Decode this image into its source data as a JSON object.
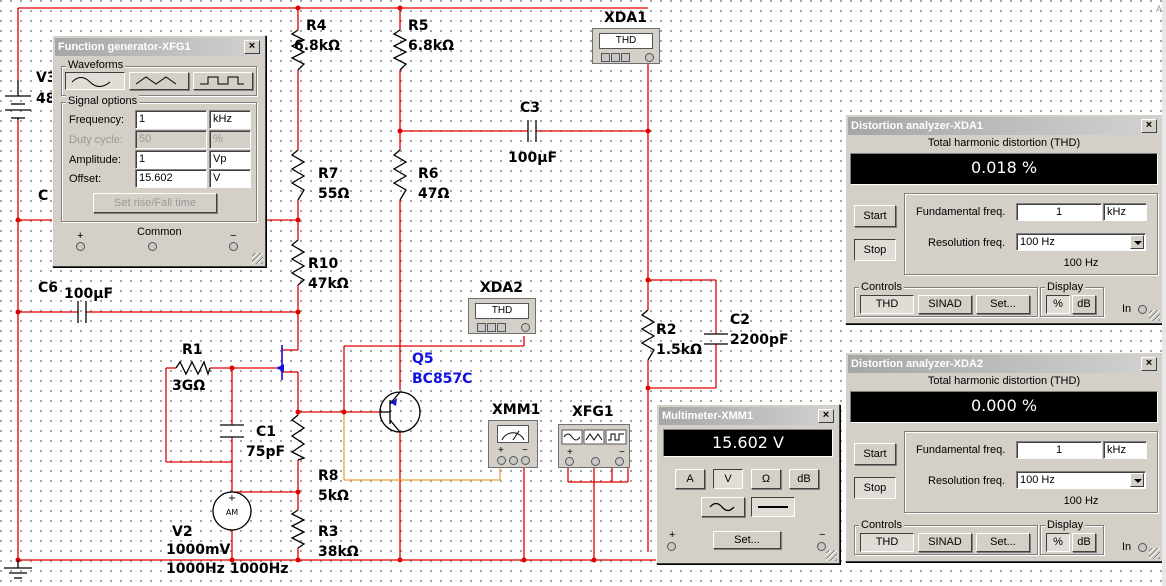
{
  "schematic": {
    "components": [
      {
        "id": "V3",
        "name": "V3",
        "value": "48"
      },
      {
        "id": "C_partial",
        "name": "C"
      },
      {
        "id": "R4",
        "name": "R4",
        "value": "6.8kΩ"
      },
      {
        "id": "R5",
        "name": "R5",
        "value": "6.8kΩ"
      },
      {
        "id": "R7",
        "name": "R7",
        "value": "55Ω"
      },
      {
        "id": "R6",
        "name": "R6",
        "value": "47Ω"
      },
      {
        "id": "R10",
        "name": "R10",
        "value": "47kΩ"
      },
      {
        "id": "C6",
        "name": "C6",
        "value": "100μF"
      },
      {
        "id": "C3",
        "name": "C3",
        "value": "100μF"
      },
      {
        "id": "R1",
        "name": "R1",
        "value": "3GΩ"
      },
      {
        "id": "C1",
        "name": "C1",
        "value": "75pF"
      },
      {
        "id": "Q5",
        "name": "Q5",
        "value": "BC857C"
      },
      {
        "id": "R8",
        "name": "R8",
        "value": "5kΩ"
      },
      {
        "id": "R3",
        "name": "R3",
        "value": "38kΩ"
      },
      {
        "id": "V2",
        "name": "V2",
        "value": "1000mV",
        "value2": "1000Hz 1000Hz"
      },
      {
        "id": "R2",
        "name": "R2",
        "value": "1.5kΩ"
      },
      {
        "id": "C2",
        "name": "C2",
        "value": "2200pF"
      }
    ],
    "instruments": {
      "xda1": {
        "name": "XDA1",
        "screen": "THD"
      },
      "xda2": {
        "name": "XDA2",
        "screen": "THD"
      },
      "xmm1": {
        "name": "XMM1",
        "plus": "+",
        "minus": "−"
      },
      "xfg1": {
        "name": "XFG1"
      },
      "am_label": "AM"
    },
    "colors": {
      "wire": "#e00000",
      "orange_wire": "#e8a040",
      "blue": "#1010e0"
    }
  },
  "function_generator": {
    "title": "Function generator-XFG1",
    "close": "×",
    "waveforms_label": "Waveforms",
    "signal_options_label": "Signal options",
    "frequency": {
      "label": "Frequency:",
      "value": "1",
      "unit": "kHz"
    },
    "duty_cycle": {
      "label": "Duty cycle:",
      "value": "50",
      "unit": "%"
    },
    "amplitude": {
      "label": "Amplitude:",
      "value": "1",
      "unit": "Vp"
    },
    "offset": {
      "label": "Offset:",
      "value": "15.602",
      "unit": "V"
    },
    "set_rise_fall": "Set rise/Fall time",
    "plus": "+",
    "common": "Common",
    "minus": "−"
  },
  "distortion_xda1": {
    "title": "Distortion analyzer-XDA1",
    "close": "×",
    "thd_label": "Total harmonic distortion (THD)",
    "reading": "0.018 %",
    "start": "Start",
    "stop": "Stop",
    "fundamental": {
      "label": "Fundamental freq.",
      "value": "1",
      "unit": "kHz"
    },
    "resolution": {
      "label": "Resolution freq.",
      "value": "100 Hz",
      "sub": "100 Hz"
    },
    "controls_label": "Controls",
    "thd_btn": "THD",
    "sinad_btn": "SINAD",
    "set_btn": "Set...",
    "display_label": "Display",
    "pct_btn": "%",
    "db_btn": "dB",
    "in_label": "In"
  },
  "distortion_xda2": {
    "title": "Distortion analyzer-XDA2",
    "close": "×",
    "thd_label": "Total harmonic distortion (THD)",
    "reading": "0.000 %",
    "start": "Start",
    "stop": "Stop",
    "fundamental": {
      "label": "Fundamental freq.",
      "value": "1",
      "unit": "kHz"
    },
    "resolution": {
      "label": "Resolution freq.",
      "value": "100 Hz",
      "sub": "100 Hz"
    },
    "controls_label": "Controls",
    "thd_btn": "THD",
    "sinad_btn": "SINAD",
    "set_btn": "Set...",
    "display_label": "Display",
    "pct_btn": "%",
    "db_btn": "dB",
    "in_label": "In"
  },
  "multimeter": {
    "title": "Multimeter-XMM1",
    "close": "×",
    "reading": "15.602 V",
    "a_btn": "A",
    "v_btn": "V",
    "ohm_btn": "Ω",
    "db_btn": "dB",
    "set_btn": "Set...",
    "plus": "+",
    "minus": "−"
  },
  "page_edge_label": "A"
}
